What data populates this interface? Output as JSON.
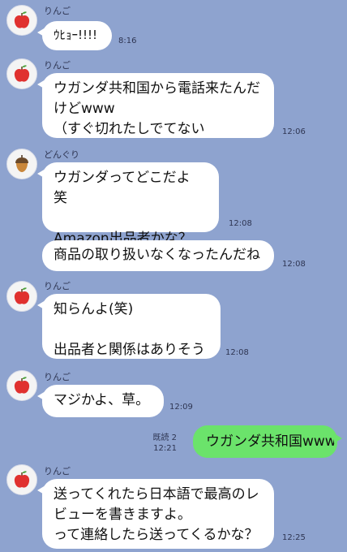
{
  "messages": [
    {
      "sender": "りんご",
      "text": "ｳﾋｮｰ!!!!",
      "time": "8:16"
    },
    {
      "sender": "りんご",
      "text": "ウガンダ共和国から電話来たんだけどwww\n（すぐ切れたしでてない",
      "time": "12:06"
    },
    {
      "sender": "どんぐり",
      "text": "ウガンダってどこだよ 笑\n\nAmazon出品者かな？",
      "time": "12:08"
    },
    {
      "sender": "",
      "text": "商品の取り扱いなくなったんだね",
      "time": "12:08"
    },
    {
      "sender": "りんご",
      "text": "知らんよ(笑)\n\n出品者と関係はありそう",
      "time": "12:08"
    },
    {
      "sender": "りんご",
      "text": "マジかよ、草。",
      "time": "12:09"
    },
    {
      "sender": "りんご",
      "text": "送ってくれたら日本語で最高のレビューを書きますよ。\nって連絡したら送ってくるかな？",
      "time": "12:25"
    }
  ],
  "outgoing": {
    "text": "ウガンダ共和国www",
    "read": "既読 2",
    "time": "12:21"
  },
  "icons": {
    "apple": "apple-icon",
    "acorn": "acorn-icon"
  },
  "colors": {
    "background": "#8ea3cf",
    "outgoing": "#6be36b",
    "incoming": "#ffffff"
  }
}
